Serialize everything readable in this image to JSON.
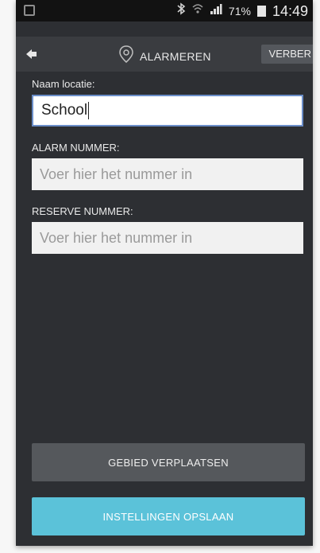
{
  "status_bar": {
    "battery_percent": "71%",
    "time": "14:49",
    "icons": [
      "notification-icon",
      "bluetooth-icon",
      "wifi-icon",
      "signal-icon",
      "battery-icon"
    ]
  },
  "action_bar": {
    "title": "ALARMEREN",
    "right_button_label": "VERBER",
    "icons": [
      "back-icon",
      "location-pin-icon"
    ]
  },
  "form": {
    "location_label": "Naam locatie:",
    "location_value": "School",
    "alarm_label": "ALARM NUMMER:",
    "alarm_placeholder": "Voer hier het nummer in",
    "reserve_label": "RESERVE NUMMER:",
    "reserve_placeholder": "Voer hier het nummer in"
  },
  "buttons": {
    "move_area": "GEBIED VERPLAATSEN",
    "save_settings": "INSTELLINGEN OPSLAAN"
  },
  "colors": {
    "background": "#2d2f33",
    "action_bar": "#3a3c40",
    "save_button": "#5bc2d9",
    "focus_border": "#6b8ec9"
  }
}
